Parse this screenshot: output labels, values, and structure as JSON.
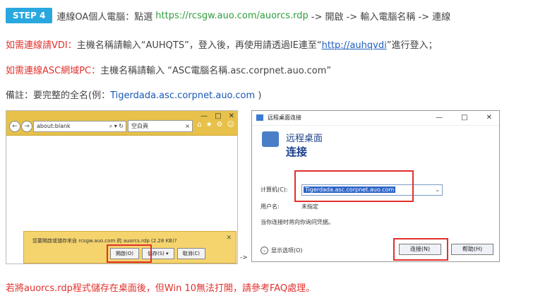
{
  "instructions": {
    "step_badge": "STEP 4",
    "line1_text": "連線OA個人電腦：點選",
    "line1_url": "https://rcsgw.auo.com/auorcs.rdp",
    "line1_tail": "-> 開啟 -> 輸入電腦名稱 -> 連線",
    "line2_red": "如需連線請VDI：",
    "line2_text": "主機名稱請輸入“AUHQTS”，登入後，再使用請透過IE連至“",
    "line2_link": "http://auhqvdi",
    "line2_tail": "”進行登入；",
    "line3_red": "如需連線ASC網域PC：",
    "line3_text": "主機名稱請輸入 “ASC電腦名稱.asc.corpnet.auo.com”",
    "line4_text": "備註：要完整的全名(例：",
    "line4_example": "Tigerdada.asc.corpnet.auo.com",
    "line4_tail": ")",
    "footer_text": "若將auorcs.rdp程式儲存在桌面後，但Win 10無法打開，請參考FAQ處理。"
  },
  "ie_screenshot": {
    "address": "about:blank",
    "address_controls": "⌕ ▾ ↻",
    "tab_label": "空白頁",
    "window_controls": [
      "—",
      "□",
      "✕"
    ],
    "download_bar": {
      "message": "您要開啟或儲存來自 rcsgw.auo.com 的 auorcs.rdp (2.28 KB)?",
      "open_label": "開啟(O)",
      "save_label": "儲存(S) ▾",
      "cancel_label": "取消(C)"
    },
    "arrow": "->"
  },
  "rdp_dialog": {
    "window_title": "远程桌面连接",
    "window_controls": [
      "—",
      "□",
      "✕"
    ],
    "header_line1": "远程桌面",
    "header_line2": "连接",
    "computer_label": "计算机(C):",
    "computer_value": "Tigerdada.asc.corpnet.auo.com",
    "username_label": "用户名:",
    "username_value": "未指定",
    "hint": "当你连接时将向你询问凭据。",
    "options_label": "显示选项(O)",
    "connect_label": "连接(N)",
    "help_label": "帮助(H)"
  }
}
